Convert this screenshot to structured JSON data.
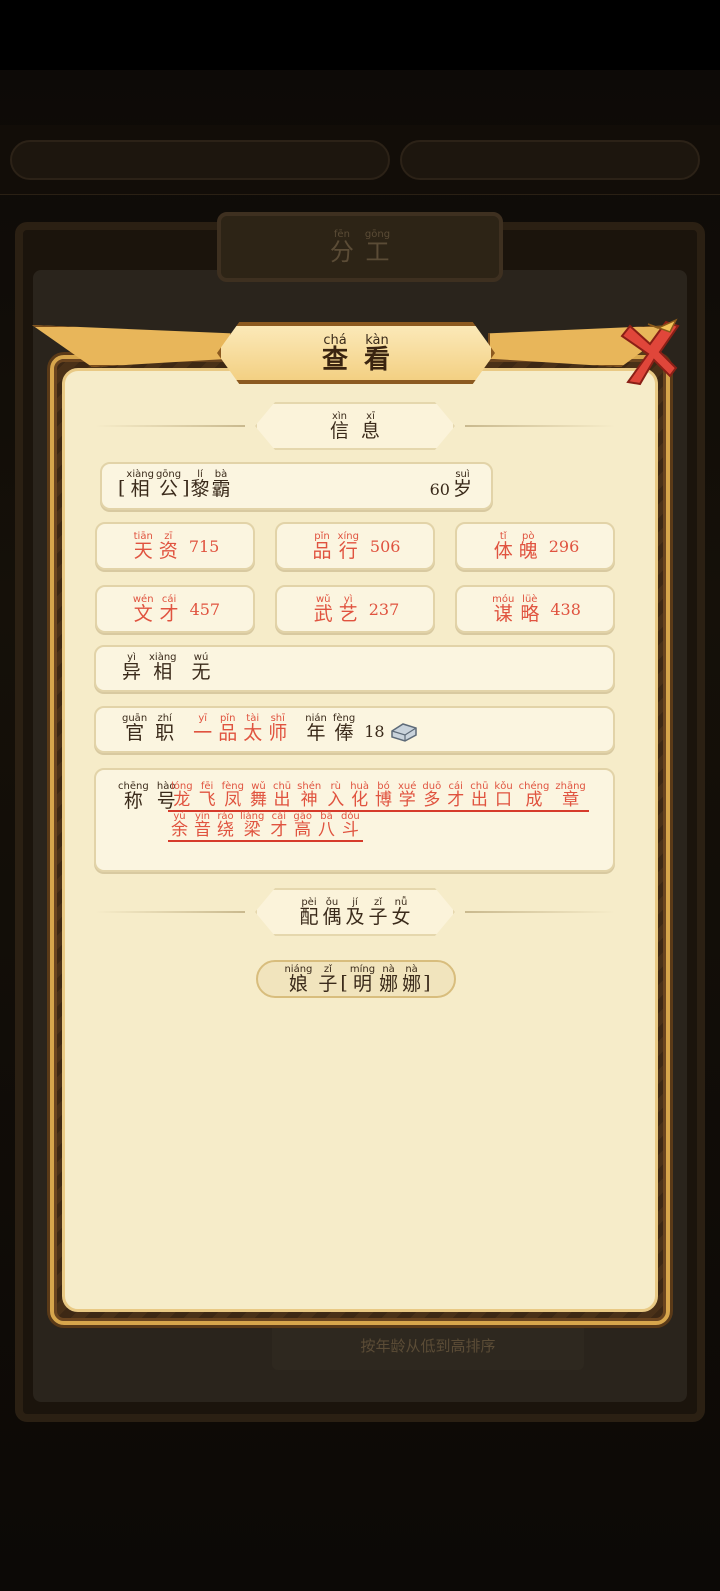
{
  "background": {
    "title": {
      "text": "分工",
      "pinyin": [
        "fēn",
        "gōng"
      ]
    },
    "sort_button": {
      "pinyin": [
        "按",
        "年龄",
        "从",
        "低",
        "到",
        "高",
        "排",
        "序"
      ],
      "text": "按年龄从低到高排序"
    }
  },
  "dialog": {
    "title": {
      "chars": [
        {
          "hz": "查",
          "py": "chá"
        },
        {
          "hz": "看",
          "py": "kàn"
        }
      ]
    },
    "section_info": {
      "chars": [
        {
          "hz": "信",
          "py": "xìn"
        },
        {
          "hz": "息",
          "py": "xī"
        }
      ]
    },
    "identity": {
      "bracket_open": "[",
      "role": [
        {
          "hz": "相",
          "py": "xiàng"
        },
        {
          "hz": "公",
          "py": "gōng"
        }
      ],
      "bracket_close": "]",
      "name": [
        {
          "hz": "黎",
          "py": "lí"
        },
        {
          "hz": "霸",
          "py": "bà"
        }
      ],
      "age": "60",
      "age_unit": {
        "hz": "岁",
        "py": "suì"
      }
    },
    "stats": [
      {
        "label": [
          {
            "hz": "天",
            "py": "tiān"
          },
          {
            "hz": "资",
            "py": "zī"
          }
        ],
        "value": "715"
      },
      {
        "label": [
          {
            "hz": "品",
            "py": "pǐn"
          },
          {
            "hz": "行",
            "py": "xíng"
          }
        ],
        "value": "506"
      },
      {
        "label": [
          {
            "hz": "体",
            "py": "tǐ"
          },
          {
            "hz": "魄",
            "py": "pò"
          }
        ],
        "value": "296"
      },
      {
        "label": [
          {
            "hz": "文",
            "py": "wén"
          },
          {
            "hz": "才",
            "py": "cái"
          }
        ],
        "value": "457"
      },
      {
        "label": [
          {
            "hz": "武",
            "py": "wǔ"
          },
          {
            "hz": "艺",
            "py": "yì"
          }
        ],
        "value": "237"
      },
      {
        "label": [
          {
            "hz": "谋",
            "py": "móu"
          },
          {
            "hz": "略",
            "py": "lüè"
          }
        ],
        "value": "438"
      }
    ],
    "appearance": {
      "label": [
        {
          "hz": "异",
          "py": "yì"
        },
        {
          "hz": "相",
          "py": "xiàng"
        }
      ],
      "value": [
        {
          "hz": "无",
          "py": "wú"
        }
      ]
    },
    "office": {
      "label": [
        {
          "hz": "官",
          "py": "guān"
        },
        {
          "hz": "职",
          "py": "zhí"
        }
      ],
      "rank": [
        {
          "hz": "一",
          "py": "yī"
        },
        {
          "hz": "品",
          "py": "pǐn"
        },
        {
          "hz": "太",
          "py": "tài"
        },
        {
          "hz": "师",
          "py": "shī"
        }
      ],
      "salary_label": [
        {
          "hz": "年",
          "py": "nián"
        },
        {
          "hz": "俸",
          "py": "fèng"
        }
      ],
      "salary_value": "18",
      "salary_icon": "silver-ingot-icon"
    },
    "titles": {
      "label": [
        {
          "hz": "称",
          "py": "chēng"
        },
        {
          "hz": "号",
          "py": "hào"
        }
      ],
      "line1": [
        {
          "hz": "龙",
          "py": "lóng"
        },
        {
          "hz": "飞",
          "py": "fēi"
        },
        {
          "hz": "凤",
          "py": "fèng"
        },
        {
          "hz": "舞",
          "py": "wǔ"
        },
        {
          "hz": "出",
          "py": "chū"
        },
        {
          "hz": "神",
          "py": "shén"
        },
        {
          "hz": "入",
          "py": "rù"
        },
        {
          "hz": "化",
          "py": "huà"
        },
        {
          "hz": "博",
          "py": "bó"
        },
        {
          "hz": "学",
          "py": "xué"
        },
        {
          "hz": "多",
          "py": "duō"
        },
        {
          "hz": "才",
          "py": "cái"
        },
        {
          "hz": "出",
          "py": "chū"
        },
        {
          "hz": "口",
          "py": "kǒu"
        },
        {
          "hz": "成",
          "py": "chéng"
        },
        {
          "hz": "章",
          "py": "zhāng"
        }
      ],
      "line2": [
        {
          "hz": "余",
          "py": "yú"
        },
        {
          "hz": "音",
          "py": "yīn"
        },
        {
          "hz": "绕",
          "py": "rào"
        },
        {
          "hz": "梁",
          "py": "liáng"
        },
        {
          "hz": "才",
          "py": "cái"
        },
        {
          "hz": "高",
          "py": "gāo"
        },
        {
          "hz": "八",
          "py": "bā"
        },
        {
          "hz": "斗",
          "py": "dǒu"
        }
      ]
    },
    "section_family": {
      "chars": [
        {
          "hz": "配",
          "py": "pèi"
        },
        {
          "hz": "偶",
          "py": "ǒu"
        },
        {
          "hz": "及",
          "py": "jí"
        },
        {
          "hz": "子",
          "py": "zǐ"
        },
        {
          "hz": "女",
          "py": "nǚ"
        }
      ]
    },
    "spouse": {
      "role": [
        {
          "hz": "娘",
          "py": "niáng"
        },
        {
          "hz": "子",
          "py": "zǐ"
        }
      ],
      "bracket_open": "[",
      "name": [
        {
          "hz": "明",
          "py": "míng"
        },
        {
          "hz": "娜",
          "py": "nà"
        },
        {
          "hz": "娜",
          "py": "nà"
        }
      ],
      "bracket_close": "]"
    }
  },
  "colors": {
    "accent_red": "#e0533f",
    "parchment": "#f6ecc9",
    "gold": "#d7a64c"
  }
}
